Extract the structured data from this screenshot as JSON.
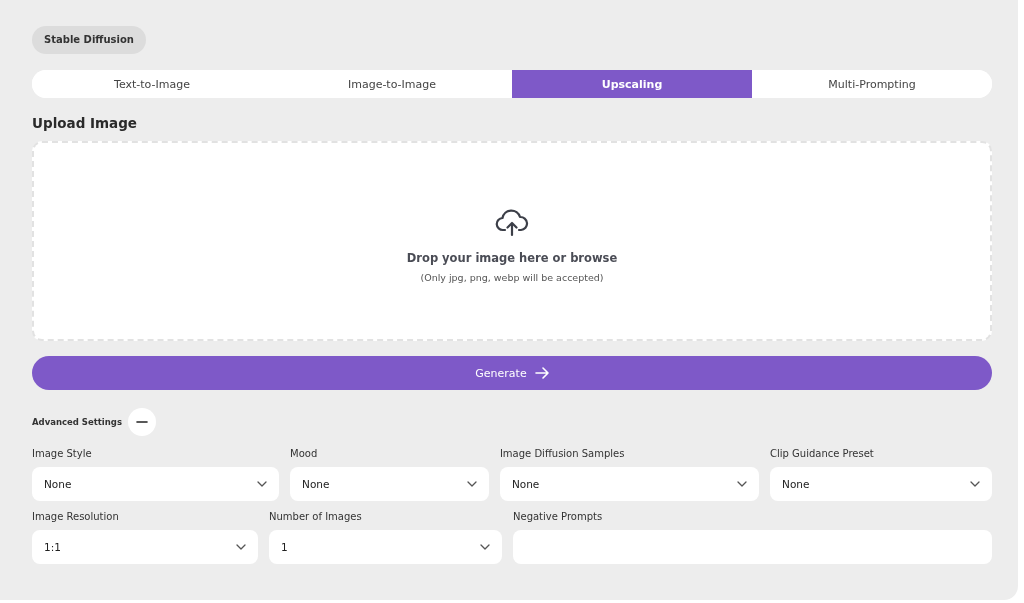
{
  "badge": "Stable Diffusion",
  "tabs": [
    {
      "label": "Text-to-Image",
      "selected": false
    },
    {
      "label": "Image-to-Image",
      "selected": false
    },
    {
      "label": "Upscaling",
      "selected": true
    },
    {
      "label": "Multi-Prompting",
      "selected": false
    }
  ],
  "upload": {
    "title": "Upload Image",
    "prompt": "Drop your image here or browse",
    "hint": "(Only jpg, png, webp will be accepted)"
  },
  "generate_button": "Generate",
  "advanced": {
    "label": "Advanced Settings",
    "expanded": true
  },
  "field_rows": [
    [
      {
        "label": "Image Style",
        "kind": "select",
        "value": "None"
      },
      {
        "label": "Mood",
        "kind": "select",
        "value": "None"
      },
      {
        "label": "Image Diffusion Samples",
        "kind": "select",
        "value": "None"
      },
      {
        "label": "Clip Guidance Preset",
        "kind": "select",
        "value": "None"
      }
    ],
    [
      {
        "label": "Image Resolution",
        "kind": "select",
        "value": "1:1"
      },
      {
        "label": "Number of Images",
        "kind": "select",
        "value": "1"
      },
      {
        "label": "Negative Prompts",
        "kind": "text"
      }
    ]
  ]
}
